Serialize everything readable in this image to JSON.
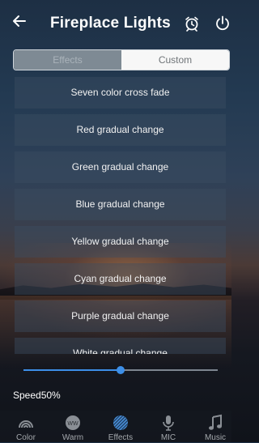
{
  "header": {
    "title": "Fireplace Lights",
    "back_icon": "back-arrow-icon",
    "alarm_icon": "alarm-clock-icon",
    "power_icon": "power-icon"
  },
  "tabs": [
    {
      "label": "Effects",
      "selected": true
    },
    {
      "label": "Custom",
      "selected": false
    }
  ],
  "effects": [
    "Seven color cross fade",
    "Red gradual change",
    "Green gradual change",
    "Blue gradual change",
    "Yellow gradual change",
    "Cyan gradual change",
    "Purple gradual change",
    "White gradual change"
  ],
  "speed": {
    "label": "Speed50%",
    "value": 0.5
  },
  "bottom_nav": [
    {
      "label": "Color",
      "icon": "rainbow-icon"
    },
    {
      "label": "Warm",
      "icon": "warm-ww-icon"
    },
    {
      "label": "Effects",
      "icon": "effects-striped-circle-icon",
      "active": true
    },
    {
      "label": "MIC",
      "icon": "microphone-icon"
    },
    {
      "label": "Music",
      "icon": "music-note-icon"
    }
  ],
  "colors": {
    "accent": "#3d8fe8",
    "nav_label": "#a4a8ad",
    "active_nav_icon": "#4a90d9"
  }
}
